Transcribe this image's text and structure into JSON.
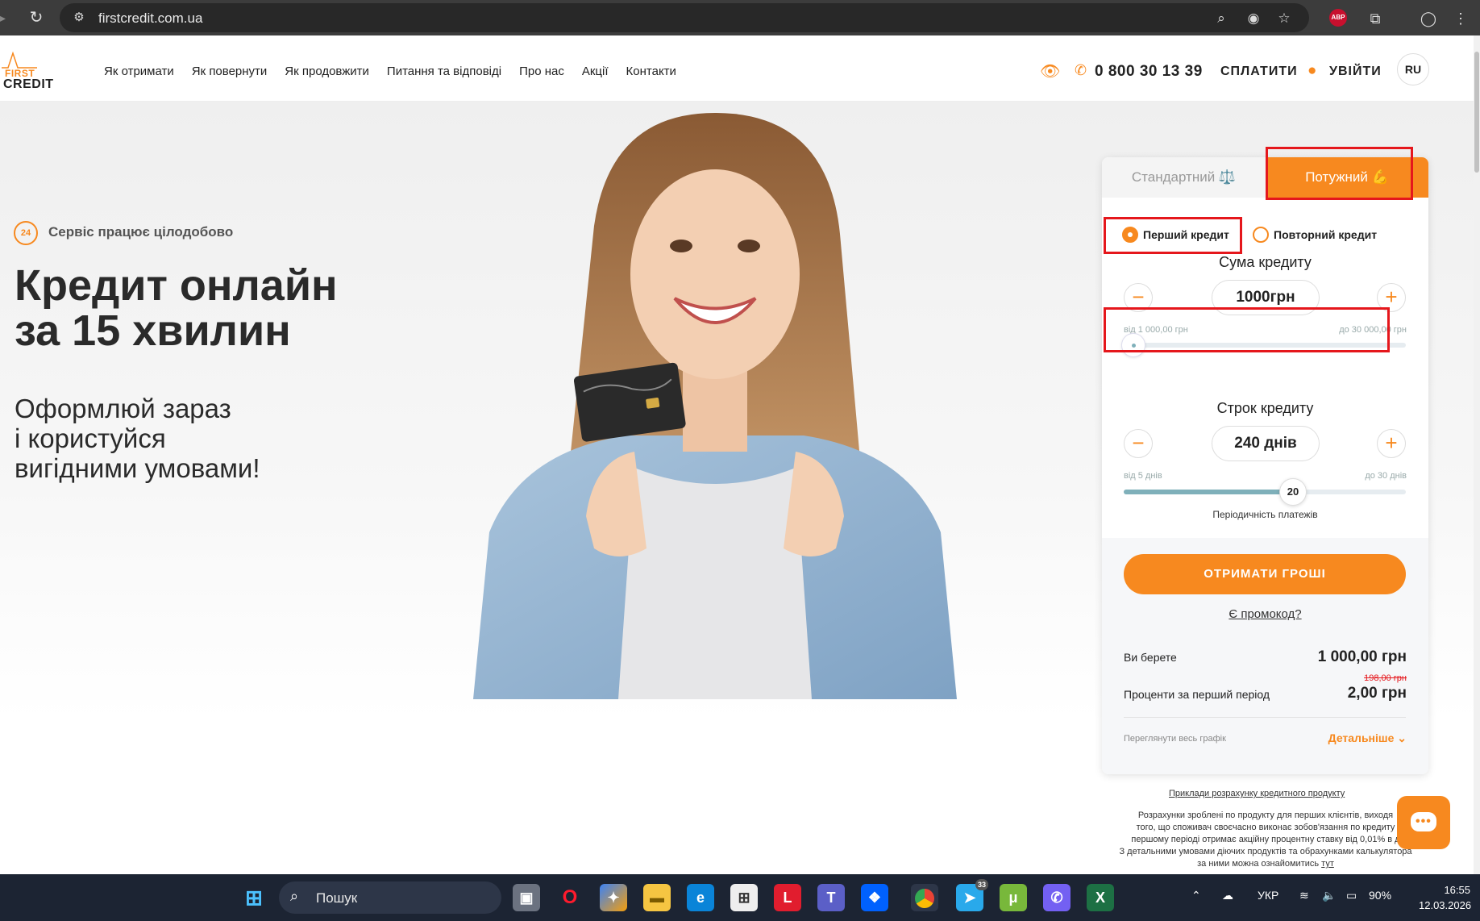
{
  "browser": {
    "url": "firstcredit.com.ua"
  },
  "logo": {
    "first": "FIRST",
    "credit": "CREDIT"
  },
  "nav": {
    "items": [
      "Як отримати",
      "Як повернути",
      "Як продовжити",
      "Питання та відповіді",
      "Про нас",
      "Акції",
      "Контакти"
    ]
  },
  "header": {
    "phone": "0 800 30 13 39",
    "pay": "СПЛАТИТИ",
    "login": "УВІЙТИ",
    "lang": "RU"
  },
  "hero": {
    "badge": "24",
    "service": "Сервіс працює цілодобово",
    "headline_1": "Кредит онлайн",
    "headline_2": "за 15 хвилин",
    "sub_1": "Оформлюй зараз",
    "sub_2": "і користуйся",
    "sub_3": "вигідними умовами!"
  },
  "calculator": {
    "tabs": {
      "standard": "Стандартний ⚖️",
      "powerful": "Потужний 💪"
    },
    "active_tab": "powerful",
    "radio": {
      "first": "Перший кредит",
      "repeat": "Повторний кредит",
      "selected": "first"
    },
    "amount": {
      "label": "Сума кредиту",
      "value": "1000грн",
      "min_label": "від 1 000,00 грн",
      "max_label": "до 30 000,00 грн",
      "position_fraction": 0
    },
    "term": {
      "label": "Строк кредиту",
      "value": "240 днів",
      "min_label": "від 5 днів",
      "max_label": "до 30 днів",
      "knob_value": "20",
      "position_fraction": 0.6,
      "period_label": "Періодичність платежів"
    },
    "cta": "ОТРИМАТИ ГРОШІ",
    "promo": "Є промокод?",
    "you_take_label": "Ви берете",
    "you_take_value": "1 000,00 грн",
    "interest_label": "Проценти за перший період",
    "interest_old": "198,00 грн",
    "interest_value": "2,00 грн",
    "schedule": "Переглянути весь графік",
    "details": "Детальніше"
  },
  "footer_note": {
    "examples": "Приклади розрахунку кредитного продукту",
    "line1": "Розрахунки зроблені по продукту для перших клієнтів, виходя",
    "line2": "того, що споживач своєчасно виконає зобов'язання по кредиту",
    "line3": "першому періоді отримає акційну процентну ставку від 0,01% в д",
    "line4": "З детальними умовами діючих продуктів та обрахунками калькулятора",
    "line5": "за ними можна ознайомитись",
    "link": "тут"
  },
  "taskbar": {
    "search": "Пошук",
    "lang": "УКР",
    "battery": "90%",
    "time": "16:55",
    "date": "12.03.2026",
    "telegram_badge": "33"
  },
  "colors": {
    "accent": "#f7891f",
    "highlight": "#e5171c",
    "track_fill": "#7fb0ba"
  }
}
